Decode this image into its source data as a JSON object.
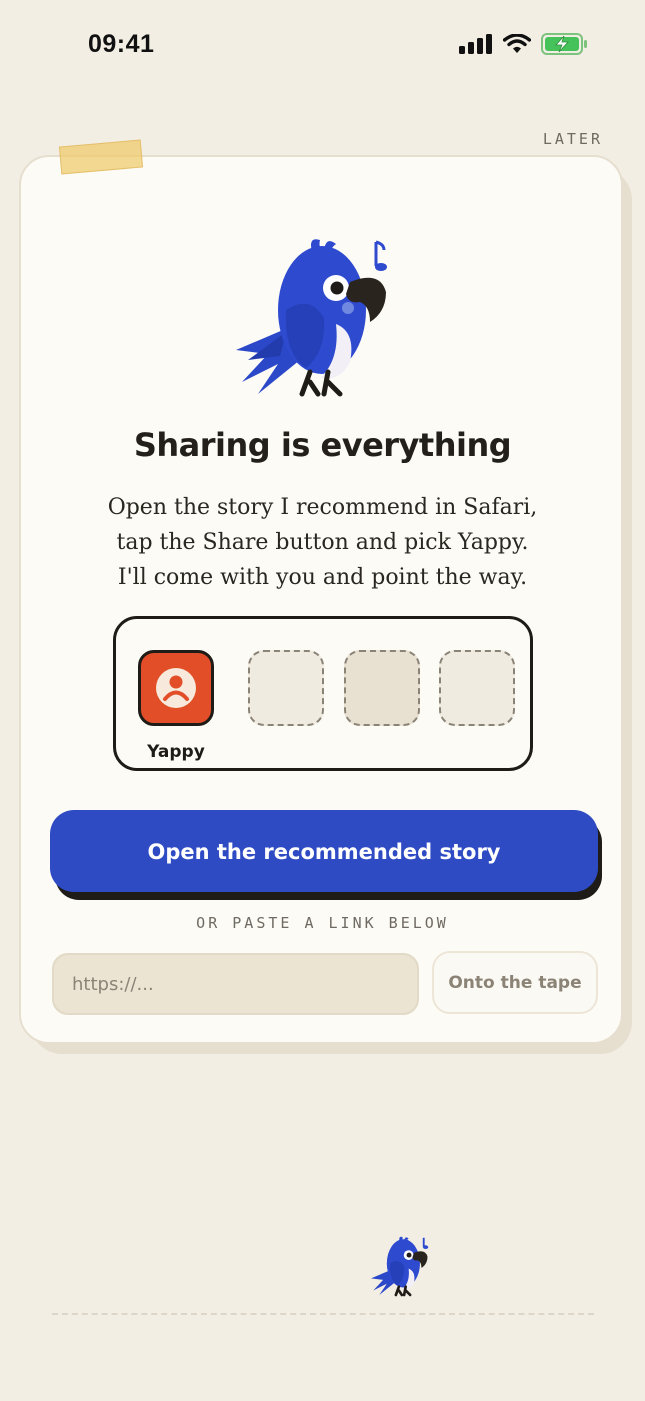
{
  "status_bar": {
    "time": "09:41",
    "icons": [
      "signal-icon",
      "wifi-icon",
      "battery-charging-icon"
    ]
  },
  "header": {
    "later_label": "LATER"
  },
  "card": {
    "headline": "Sharing is everything",
    "body_lines": [
      "Open the story I recommend in Safari,",
      "tap the Share button and pick Yappy.",
      "I'll come with you and point the way."
    ],
    "share_sheet": {
      "app_label": "Yappy",
      "app_icon": "user-icon",
      "placeholder_slots": 3
    },
    "cta_label": "Open the recommended story",
    "divider_label": "OR PASTE A LINK BELOW",
    "link_placeholder": "https://...",
    "submit_label": "Onto the tape"
  },
  "colors": {
    "background": "#f3eee4",
    "card": "#fcfbf6",
    "primary": "#2e4bc4",
    "yappy_tile": "#e24e28",
    "text": "#1f1b16"
  }
}
